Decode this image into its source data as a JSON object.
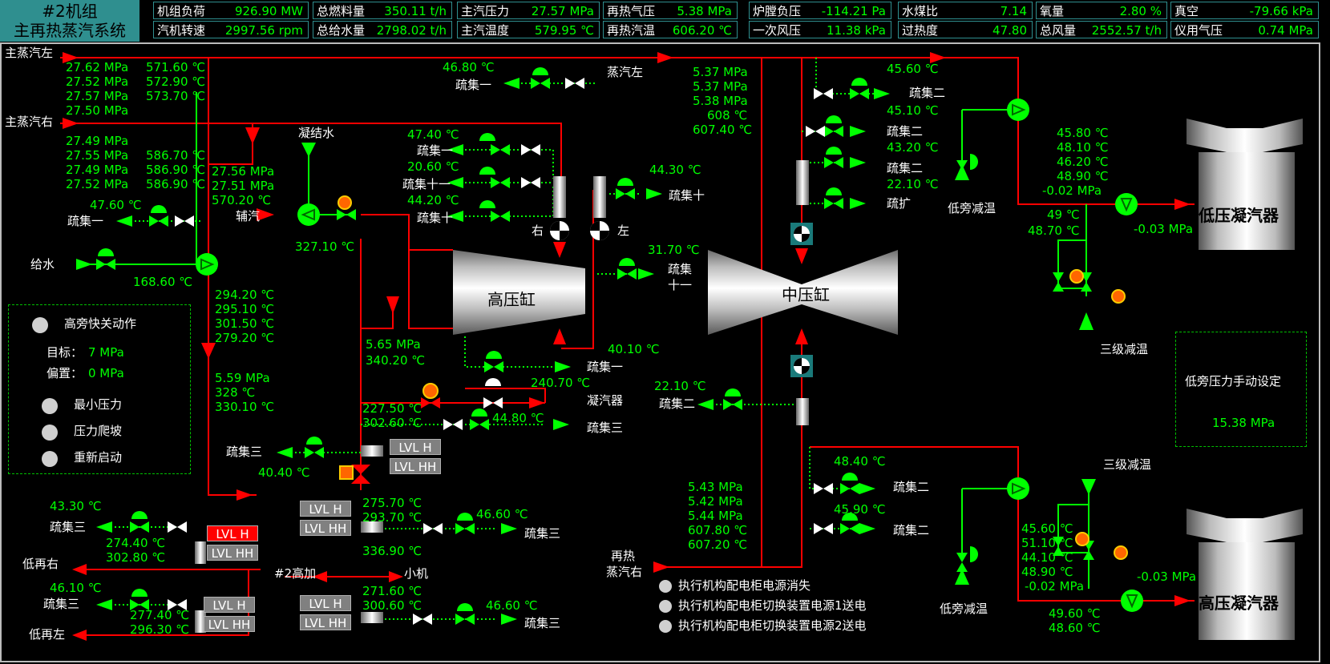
{
  "header": {
    "unit": "#2机组",
    "system": "主再热蒸汽系统",
    "cells": [
      {
        "label": "机组负荷",
        "value": "926.90 MW"
      },
      {
        "label": "汽机转速",
        "value": "2997.56 rpm"
      },
      {
        "label": "总燃料量",
        "value": "350.11 t/h"
      },
      {
        "label": "总给水量",
        "value": "2798.02 t/h"
      },
      {
        "label": "主汽压力",
        "value": "27.57 MPa"
      },
      {
        "label": "主汽温度",
        "value": "579.95 ℃"
      },
      {
        "label": "再热气压",
        "value": "5.38 MPa"
      },
      {
        "label": "再热汽温",
        "value": "606.20 ℃"
      },
      {
        "label": "炉膛负压",
        "value": "-114.21 Pa"
      },
      {
        "label": "一次风压",
        "value": "11.38 kPa"
      },
      {
        "label": "水煤比",
        "value": "7.14"
      },
      {
        "label": "过热度",
        "value": "47.80"
      },
      {
        "label": "氧量",
        "value": "2.80 %"
      },
      {
        "label": "总风量",
        "value": "2552.57 t/h"
      },
      {
        "label": "真空",
        "value": "-79.66 kPa"
      },
      {
        "label": "仪用气压",
        "value": "0.74 MPa"
      }
    ]
  },
  "labels": {
    "main_steam_left": "主蒸汽左",
    "main_steam_right": "主蒸汽右",
    "condensate": "凝结水",
    "aux_steam": "辅汽",
    "feedwater": "给水",
    "steam_left": "蒸汽左",
    "drain1": "疏集一",
    "drain2": "疏集二",
    "drain3": "疏集三",
    "drain10": "疏集十",
    "drain11": "疏集十一",
    "drain_ext": "疏扩",
    "drain11b_1": "疏集",
    "drain11b_2": "十一",
    "right": "右",
    "left": "左",
    "hp_cyl": "高压缸",
    "ip_cyl": "中压缸",
    "lp_cond": "低压凝汽器",
    "hp_cond": "高压凝汽器",
    "lp_bypass_desup": "低旁减温",
    "third_desup": "三级减温",
    "condenser": "凝汽器",
    "cold_rh_right": "低再右",
    "cold_rh_left": "低再左",
    "hp_heater2": "#2高加",
    "small_turbine": "小机",
    "reheat1": "再热",
    "reheat2": "蒸汽右",
    "lvl_h": "LVL H",
    "lvl_hh": "LVL HH"
  },
  "values": {
    "ms_l_p": [
      "27.62 MPa",
      "27.52 MPa",
      "27.57 MPa",
      "27.50 MPa"
    ],
    "ms_l_t": [
      "571.60 ℃",
      "572.90 ℃",
      "573.70 ℃"
    ],
    "ms_r_p": [
      "27.49 MPa",
      "27.55 MPa",
      "27.49 MPa",
      "27.52 MPa"
    ],
    "ms_r_t": [
      "586.70 ℃",
      "586.90 ℃",
      "586.90 ℃"
    ],
    "bypass": [
      "27.56 MPa",
      "27.51 MPa",
      "570.20 ℃"
    ],
    "drain1_t": "47.60 ℃",
    "fw_t": "168.60 ℃",
    "aux_t": "327.10 ℃",
    "top_d1": "46.80 ℃",
    "d_47": "47.40 ℃",
    "d_20": "20.60 ℃",
    "d_44": "44.20 ℃",
    "d_443": "44.30 ℃",
    "d_317": "31.70 ℃",
    "d_401": "40.10 ℃",
    "rh_vals": [
      "5.37 MPa",
      "5.37 MPa",
      "5.38 MPa",
      "608 ℃",
      "607.40 ℃"
    ],
    "ip_d1": "45.60 ℃",
    "ip_d2": "45.10 ℃",
    "ip_d3": "43.20 ℃",
    "ip_d4": "22.10 ℃",
    "lp_vals": [
      "45.80 ℃",
      "48.10 ℃",
      "46.20 ℃",
      "48.90 ℃",
      "-0.02 MPa"
    ],
    "lp_out": [
      "49 ℃",
      "48.70 ℃"
    ],
    "lp_p": "-0.03 MPa",
    "cold_vals": [
      "294.20 ℃",
      "295.10 ℃",
      "301.50 ℃",
      "279.20 ℃"
    ],
    "cold2": [
      "5.59 MPa",
      "328 ℃",
      "330.10 ℃"
    ],
    "hp_ex": [
      "5.65 MPa",
      "340.20 ℃"
    ],
    "d_2407": "240.70 ℃",
    "d_448": "44.80 ℃",
    "v_2275": [
      "227.50 ℃",
      "302.60 ℃"
    ],
    "d_404": "40.40 ℃",
    "ip_exh_d": "22.10 ℃",
    "d_433": "43.30 ℃",
    "v_2744": [
      "274.40 ℃",
      "302.80 ℃"
    ],
    "v_2757": [
      "275.70 ℃",
      "293.70 ℃"
    ],
    "d_466a": "46.60 ℃",
    "v_3369": "336.90 ℃",
    "d_461": "46.10 ℃",
    "v_2774": [
      "277.40 ℃",
      "296.30 ℃"
    ],
    "v_2716": [
      "271.60 ℃",
      "300.60 ℃"
    ],
    "d_466b": "46.60 ℃",
    "rh_r_vals": [
      "5.43 MPa",
      "5.42 MPa",
      "5.44 MPa",
      "607.80 ℃",
      "607.20 ℃"
    ],
    "ip_lo1": "48.40 ℃",
    "ip_lo2": "45.90 ℃",
    "hp_cond_vals": [
      "45.60 ℃",
      "51.10 ℃",
      "44.10 ℃",
      "48.90 ℃",
      "-0.02 MPa"
    ],
    "hp_cond_p": "-0.03 MPa",
    "hp_cond_out": [
      "49.60 ℃",
      "48.60 ℃"
    ]
  },
  "bypass_panel": {
    "fast_open": "高旁快关动作",
    "target_label": "目标：",
    "target_value": "7 MPa",
    "bias_label": "偏置：",
    "bias_value": "0 MPa",
    "min_pressure": "最小压力",
    "ramp": "压力爬坡",
    "restart": "重新启动"
  },
  "lp_panel": {
    "title": "低旁压力手动设定",
    "value": "15.38 MPa"
  },
  "power_status": [
    "执行机构配电柜电源消失",
    "执行机构配电柜切换装置电源1送电",
    "执行机构配电柜切换装置电源2送电"
  ]
}
